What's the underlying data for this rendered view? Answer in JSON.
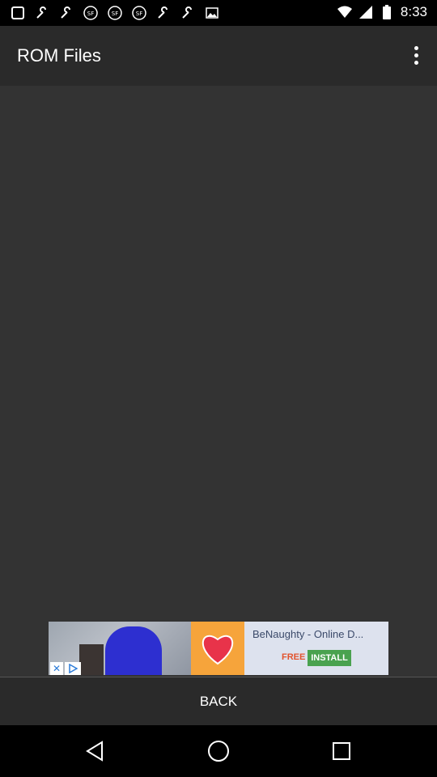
{
  "status_bar": {
    "time": "8:33",
    "left_icons": [
      "notification-icon",
      "wrench-icon",
      "wrench-icon",
      "sf-icon",
      "sf-icon",
      "sf-icon",
      "wrench-icon",
      "wrench-icon",
      "image-icon"
    ],
    "right_icons": [
      "wifi-icon",
      "signal-icon",
      "battery-icon"
    ]
  },
  "app_bar": {
    "title": "ROM Files",
    "menu_icon": "overflow-menu-icon"
  },
  "ad": {
    "title": "BeNaughty - Online D...",
    "free_label": "FREE",
    "install_label": "INSTALL",
    "close_icon": "close-icon",
    "adchoices_icon": "adchoices-icon"
  },
  "bottom": {
    "back_label": "BACK"
  },
  "nav": {
    "items": [
      "back-nav-icon",
      "home-nav-icon",
      "recents-nav-icon"
    ]
  },
  "colors": {
    "app_bar": "#2a2a2a",
    "content": "#333333",
    "ad_heart": "#f6a43b",
    "install": "#4aa24f"
  }
}
